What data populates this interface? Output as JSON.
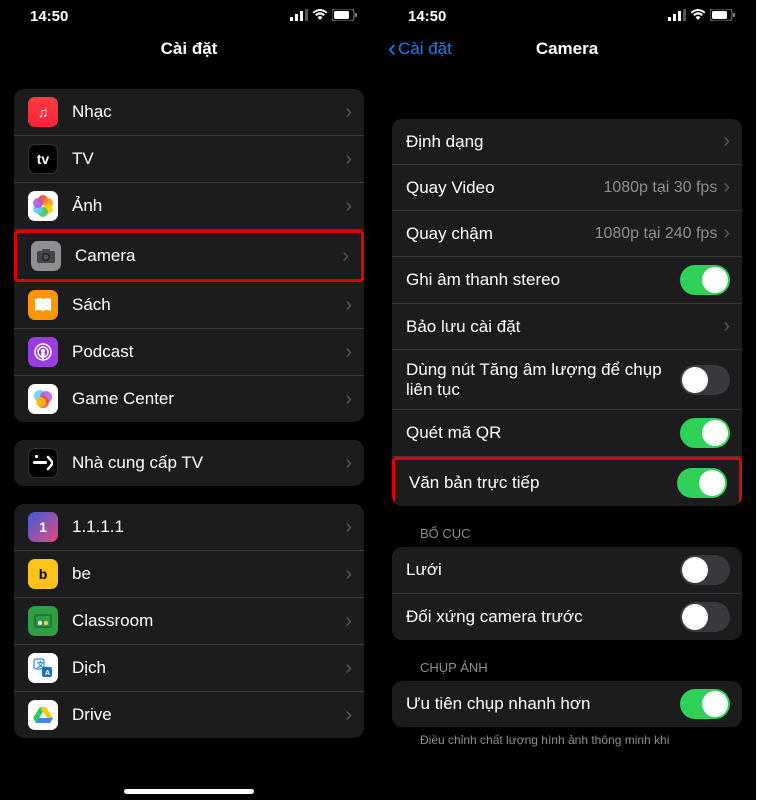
{
  "left": {
    "status": {
      "time": "14:50"
    },
    "header": {
      "title": "Cài đặt"
    },
    "section1": [
      {
        "label": "Nhạc",
        "icon": "music"
      },
      {
        "label": "TV",
        "icon": "tv"
      },
      {
        "label": "Ảnh",
        "icon": "photos"
      },
      {
        "label": "Camera",
        "icon": "camera",
        "highlight": true
      },
      {
        "label": "Sách",
        "icon": "books"
      },
      {
        "label": "Podcast",
        "icon": "podcast"
      },
      {
        "label": "Game Center",
        "icon": "gamecenter"
      }
    ],
    "section2": [
      {
        "label": "Nhà cung cấp TV",
        "icon": "tvprov"
      }
    ],
    "section3": [
      {
        "label": "1.1.1.1",
        "icon": "1111"
      },
      {
        "label": "be",
        "icon": "be"
      },
      {
        "label": "Classroom",
        "icon": "classroom"
      },
      {
        "label": "Dịch",
        "icon": "translate"
      },
      {
        "label": "Drive",
        "icon": "drive"
      }
    ]
  },
  "right": {
    "status": {
      "time": "14:50"
    },
    "header": {
      "back": "Cài đặt",
      "title": "Camera"
    },
    "rows": {
      "format": "Định dạng",
      "video": {
        "label": "Quay Video",
        "value": "1080p tại 30 fps"
      },
      "slomo": {
        "label": "Quay chậm",
        "value": "1080p tại 240 fps"
      },
      "stereo": {
        "label": "Ghi âm thanh stereo",
        "on": true
      },
      "preserve": "Bảo lưu cài đặt",
      "volume_burst": {
        "label": "Dùng nút Tăng âm lượng để chụp liên tục",
        "on": false
      },
      "qr": {
        "label": "Quét mã QR",
        "on": true
      },
      "live_text": {
        "label": "Văn bản trực tiếp",
        "on": true,
        "highlight": true
      }
    },
    "section_layout_header": "BỐ CỤC",
    "layout_rows": {
      "grid": {
        "label": "Lưới",
        "on": false
      },
      "mirror": {
        "label": "Đối xứng camera trước",
        "on": false
      }
    },
    "section_capture_header": "CHỤP ẢNH",
    "capture_rows": {
      "prioritize": {
        "label": "Ưu tiên chụp nhanh hơn",
        "on": true
      }
    },
    "footer": "Điều chỉnh chất lượng hình ảnh thông minh khi"
  }
}
